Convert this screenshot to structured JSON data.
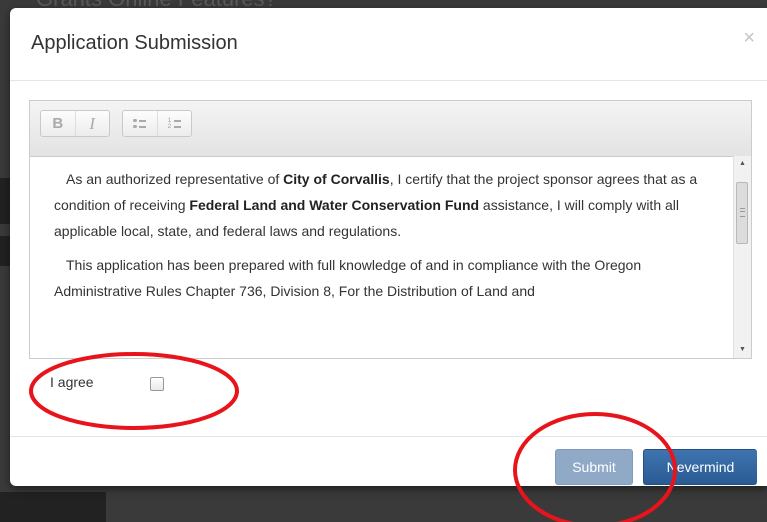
{
  "background": {
    "heading": "Grants Online Features?"
  },
  "modal": {
    "title": "Application Submission",
    "close_icon": "×"
  },
  "toolbar": {
    "bold_label": "B",
    "italic_label": "I",
    "bullet_list_icon": "bulleted-list-icon",
    "numbered_list_icon": "numbered-list-icon"
  },
  "content": {
    "para1": {
      "part1": "As an authorized representative of ",
      "org": "City of Corvallis",
      "part2": ", I certify that the project sponsor agrees that as a condition of receiving ",
      "fund": "Federal Land and Water Conservation Fund",
      "part3": " assistance, I will comply with all applicable local, state, and federal laws and regulations."
    },
    "para2": "This application has been prepared with full knowledge of and in compliance with the Oregon Administrative Rules Chapter 736, Division 8, For the Distribution of Land and"
  },
  "agree": {
    "label": "I agree",
    "checked": false
  },
  "buttons": {
    "submit": "Submit",
    "nevermind": "Nevermind"
  },
  "colors": {
    "annotation": "#e8141c",
    "primary_button": "#2f649f",
    "disabled_button": "#8fa9c7"
  }
}
